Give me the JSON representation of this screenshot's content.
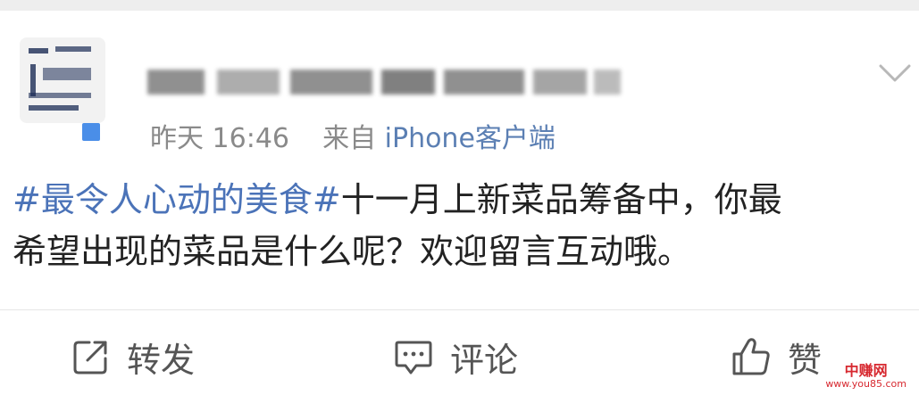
{
  "post": {
    "time": "昨天 16:46",
    "source_prefix": "来自",
    "source": "iPhone客户端",
    "hashtag": "#最令人心动的美食#",
    "text_line1": "十一月上新菜品筹备中，你最",
    "text_line2": "希望出现的菜品是什么呢？欢迎留言互动哦。"
  },
  "actions": {
    "repost": "转发",
    "comment": "评论",
    "like": "赞"
  },
  "watermark": {
    "brand": "中赚网",
    "url": "www.you85.com"
  },
  "colors": {
    "link": "#4b73b8",
    "meta": "#8a8a8a",
    "badge": "#4a8ee8"
  }
}
